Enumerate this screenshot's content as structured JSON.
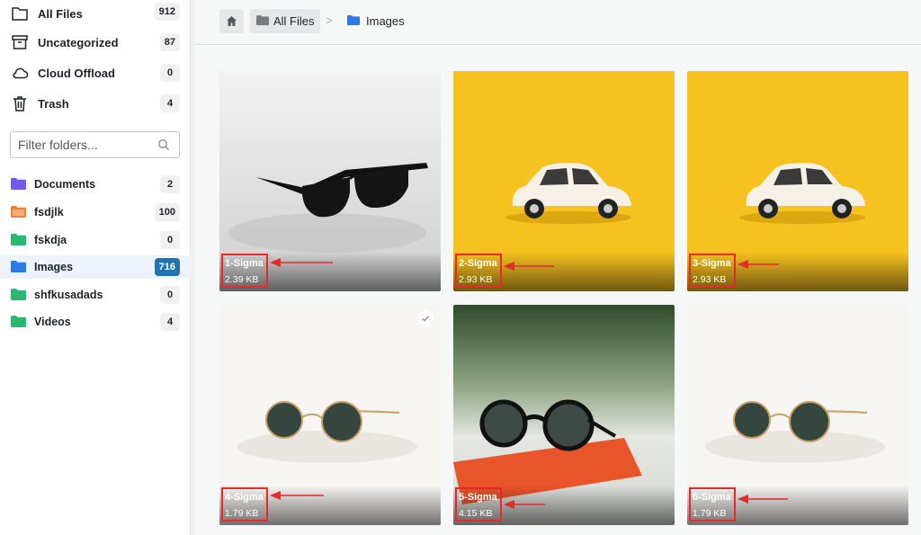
{
  "sidebar": {
    "nav": [
      {
        "label": "All Files",
        "count": "912",
        "icon": "folder-outline-icon"
      },
      {
        "label": "Uncategorized",
        "count": "87",
        "icon": "archive-icon"
      },
      {
        "label": "Cloud Offload",
        "count": "0",
        "icon": "cloud-icon"
      },
      {
        "label": "Trash",
        "count": "4",
        "icon": "trash-icon"
      }
    ],
    "search": {
      "placeholder": "Filter folders..."
    },
    "folders": [
      {
        "label": "Documents",
        "count": "2",
        "color": "#6c5ce7"
      },
      {
        "label": "fsdjlk",
        "count": "100",
        "color": "#f08030"
      },
      {
        "label": "fskdja",
        "count": "0",
        "color": "#2bb673"
      },
      {
        "label": "Images",
        "count": "716",
        "color": "#2d7be5",
        "active": true
      },
      {
        "label": "shfkusadads",
        "count": "0",
        "color": "#2bb673"
      },
      {
        "label": "Videos",
        "count": "4",
        "color": "#2bb673"
      }
    ]
  },
  "breadcrumb": {
    "home_icon": "home-icon",
    "items": [
      "All Files",
      "Images"
    ],
    "separator": ">"
  },
  "grid": {
    "files": [
      {
        "title": "1-Sigma",
        "size": "2.39 KB",
        "subject": "sunglasses on white"
      },
      {
        "title": "2-Sigma",
        "size": "2.93 KB",
        "subject": "white car on yellow"
      },
      {
        "title": "3-Sigma",
        "size": "2.93 KB",
        "subject": "white car on yellow"
      },
      {
        "title": "4-Sigma",
        "size": "1.79 KB",
        "subject": "round glasses",
        "selected": true
      },
      {
        "title": "5-Sigma",
        "size": "4.15 KB",
        "subject": "round glasses on supreme"
      },
      {
        "title": "6-Sigma",
        "size": "1.79 KB",
        "subject": "round glasses"
      }
    ]
  },
  "colors": {
    "accent": "#2271b1",
    "highlight": "#e8282b",
    "yellow_bg": "#f7c21f"
  }
}
